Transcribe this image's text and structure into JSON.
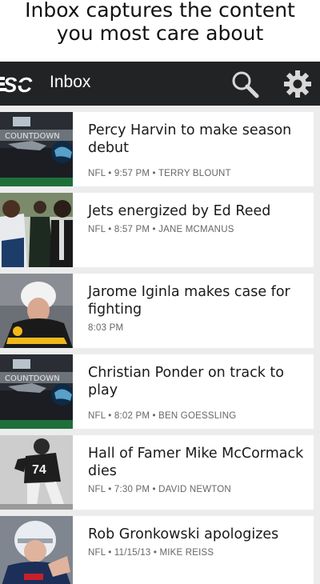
{
  "promo": {
    "line1": "Inbox captures the content",
    "line2": "you most care about"
  },
  "appbar": {
    "logo_text": "SC",
    "title": "Inbox",
    "search_icon": "search-icon",
    "settings_icon": "gear-icon"
  },
  "stories": [
    {
      "headline": "Percy Harvin to make season debut",
      "meta": "NFL • 9:57 PM • TERRY BLOUNT",
      "thumb_text": "COUNTDOWN"
    },
    {
      "headline": "Jets energized by Ed Reed",
      "meta": "NFL • 8:57 PM • JANE MCMANUS"
    },
    {
      "headline": "Jarome Iginla makes case for fighting",
      "meta": "8:03 PM"
    },
    {
      "headline": "Christian Ponder on track to play",
      "meta": "NFL • 8:02 PM • BEN GOESSLING",
      "thumb_text": "COUNTDOWN"
    },
    {
      "headline": "Hall of Famer Mike McCormack dies",
      "meta": "NFL • 7:30 PM • DAVID NEWTON"
    },
    {
      "headline": "Rob Gronkowski apologizes",
      "meta": "NFL • 11/15/13 • MIKE REISS"
    }
  ]
}
